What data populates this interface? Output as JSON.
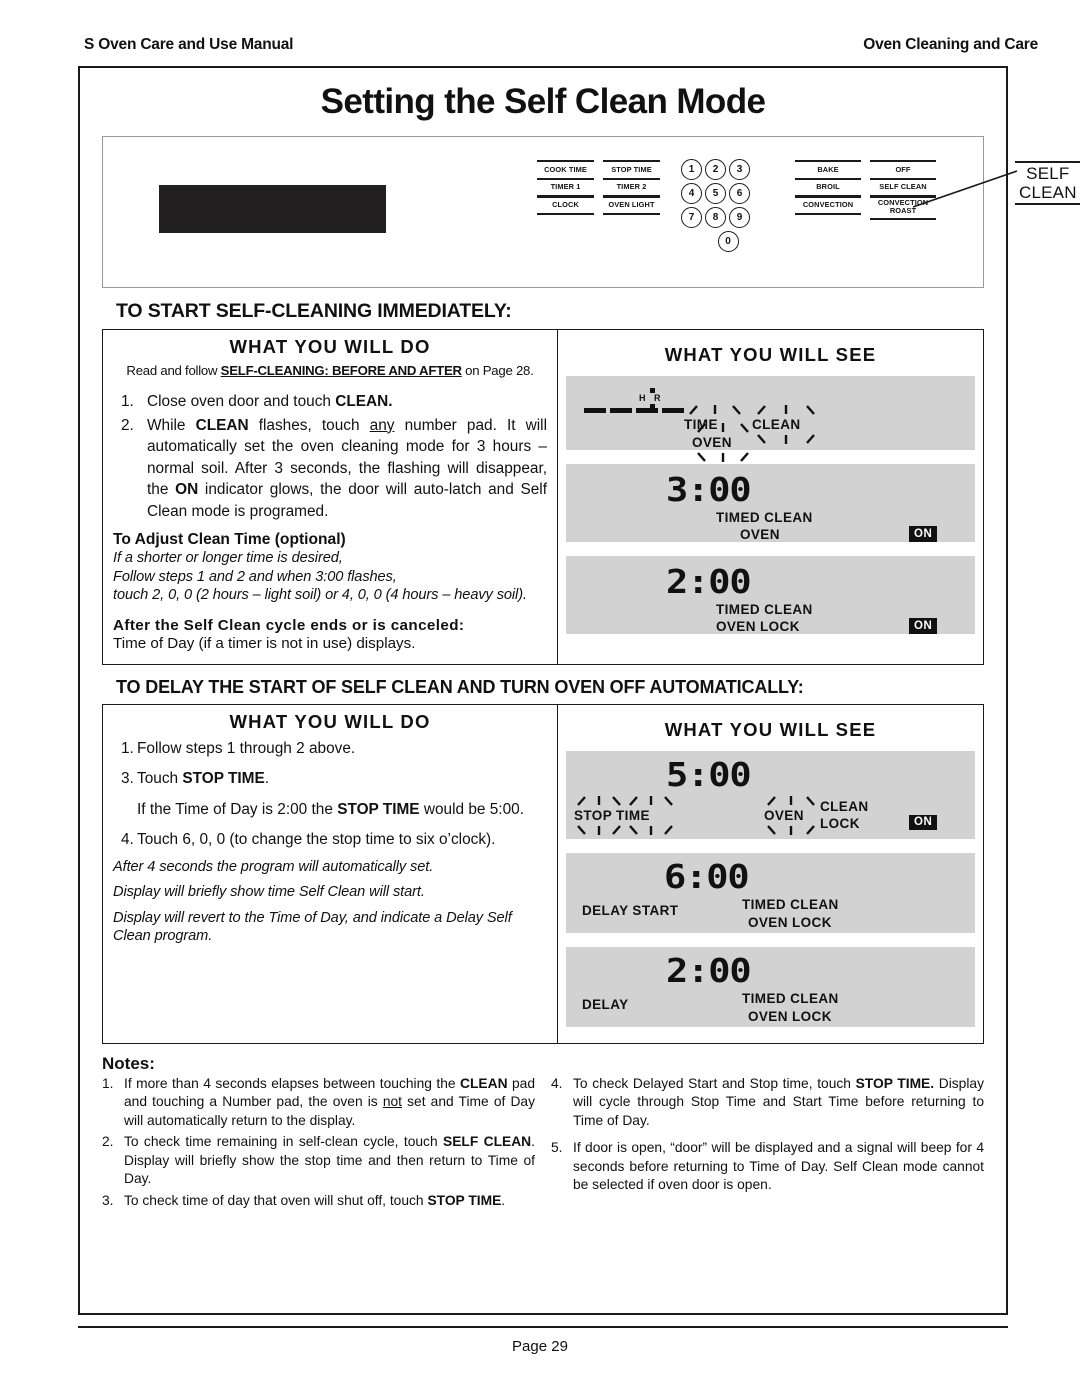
{
  "runhead": {
    "left": "S Oven Care and Use Manual",
    "right": "Oven Cleaning and Care"
  },
  "title": "Setting the Self Clean Mode",
  "control_panel": {
    "left_keys": [
      [
        "COOK TIME",
        "TIMER 1",
        "CLOCK"
      ],
      [
        "STOP TIME",
        "TIMER 2",
        "OVEN LIGHT"
      ]
    ],
    "numpad": [
      [
        "1",
        "2",
        "3"
      ],
      [
        "4",
        "5",
        "6"
      ],
      [
        "7",
        "8",
        "9"
      ],
      [
        "0"
      ]
    ],
    "right_keys": [
      [
        "BAKE",
        "BROIL",
        "CONVECTION"
      ],
      [
        "OFF",
        "SELF CLEAN",
        "CONVECTION ROAST"
      ]
    ],
    "callout": "SELF CLEAN"
  },
  "section1": {
    "heading": "TO START SELF-CLEANING IMMEDIATELY:",
    "do_header": "WHAT  YOU  WILL DO",
    "see_header": "WHAT  YOU  WILL SEE",
    "lead_pre": "Read and follow ",
    "lead_bold": "SELF-CLEANING: BEFORE AND AFTER",
    "lead_post": " on Page 28.",
    "step1_num": "1.",
    "step1_a": "Close oven door and touch ",
    "step1_b": "CLEAN.",
    "step2_num": "2.",
    "step2_a": "While ",
    "step2_b": "CLEAN",
    "step2_c": " flashes, touch ",
    "step2_d": "any",
    "step2_e": " number pad. It will automatically set the oven cleaning mode for 3 hours – normal soil. After 3 seconds, the flashing will disappear, the ",
    "step2_f": "ON",
    "step2_g": " indicator glows, the door will auto-latch and Self Clean mode is programed.",
    "adjust_head": "To Adjust Clean Time (optional)",
    "adjust_l1": "If a shorter or longer time is desired,",
    "adjust_l2": "Follow steps 1 and 2 and when 3:00 flashes,",
    "adjust_l3": "touch  2, 0, 0 (2 hours – light soil) or 4, 0, 0  (4 hours – heavy soil).",
    "after_head": "After the Self Clean cycle ends or is canceled:",
    "after_body": "Time of Day (if a timer is not in use) displays."
  },
  "section1_displays": [
    {
      "id": "display-dashes",
      "digits": "",
      "hr_label": "H R",
      "flash_labels": [
        "TIME",
        "CLEAN",
        "OVEN"
      ],
      "static_labels": [],
      "on_badge": ""
    },
    {
      "id": "display-300",
      "digits": "3:00",
      "static_labels": [
        "TIMED CLEAN",
        "OVEN"
      ],
      "on_badge": "ON"
    },
    {
      "id": "display-200",
      "digits": "2:00",
      "static_labels": [
        "TIMED CLEAN",
        "OVEN LOCK"
      ],
      "on_badge": "ON"
    }
  ],
  "section2": {
    "heading": "TO DELAY  THE START OF SELF CLEAN AND TURN OVEN OFF AUTOMATICALLY:",
    "do_header": "WHAT  YOU  WILL DO",
    "see_header": "WHAT  YOU  WILL SEE",
    "step1_num": "1.",
    "step1_txt": "Follow steps 1 through 2 above.",
    "step3_num": "3.",
    "step3_a": "Touch ",
    "step3_b": "STOP TIME",
    "step3_c": ".",
    "step3_note_a": "If the Time of Day is 2:00 the ",
    "step3_note_b": "STOP  TIME",
    "step3_note_c": " would be 5:00.",
    "step4_num": "4.",
    "step4_txt": "Touch 6, 0, 0  (to change the stop time to six o’clock).",
    "ital1": "After 4 seconds the program will automatically set.",
    "ital2": "Display will briefly show time Self Clean will start.",
    "ital3": "Display will revert to the Time of Day, and indicate a Delay Self Clean program."
  },
  "section2_displays": [
    {
      "id": "display-500",
      "digits": "5:00",
      "flash_labels": [
        "STOP  TIME",
        "OVEN"
      ],
      "static_labels": [
        "CLEAN",
        "LOCK"
      ],
      "on_badge": "ON"
    },
    {
      "id": "display-600",
      "digits": "6:00",
      "left_label": "DELAY START",
      "static_labels": [
        "TIMED CLEAN",
        "OVEN LOCK"
      ],
      "on_badge": ""
    },
    {
      "id": "display-200-delay",
      "digits": "2:00",
      "left_label": "DELAY",
      "static_labels": [
        "TIMED CLEAN",
        "OVEN LOCK"
      ],
      "on_badge": ""
    }
  ],
  "notes": {
    "title": "Notes:",
    "left": [
      {
        "num": "1.",
        "a": "If more than 4 seconds elapses between touching the ",
        "b": "CLEAN",
        "c": " pad and touching a Number pad, the oven is ",
        "d": "not",
        "e": " set and Time of Day will automatically return to the display."
      },
      {
        "num": "2.",
        "a": "To check time remaining in self-clean cycle, touch ",
        "b": "SELF CLEAN",
        "c": ".  Display will briefly show the stop time and then return to Time of Day."
      },
      {
        "num": "3.",
        "a": "To check time of day that oven will shut off, touch ",
        "b": "STOP TIME",
        "c": "."
      }
    ],
    "right": [
      {
        "num": "4.",
        "a": "To check Delayed Start and Stop time, touch ",
        "b": "STOP TIME.",
        "c": " Display will cycle through Stop Time and Start Time before returning to Time of Day."
      },
      {
        "num": "5.",
        "a": "If door is open, “door” will be displayed and a signal will beep for 4 seconds before returning to Time of Day.  Self Clean mode cannot be selected if oven door is open.",
        "b": "",
        "c": ""
      }
    ]
  },
  "footer": {
    "page": "Page 29"
  }
}
